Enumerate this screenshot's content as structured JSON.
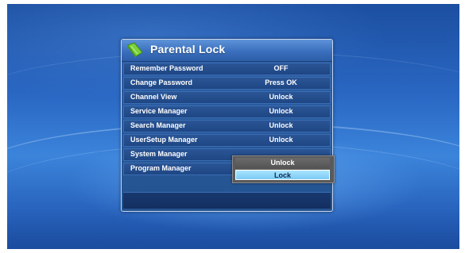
{
  "dialog": {
    "title": "Parental Lock",
    "icon": "green-book-icon"
  },
  "rows": [
    {
      "label": "Remember Password",
      "value": "OFF"
    },
    {
      "label": "Change Password",
      "value": "Press OK"
    },
    {
      "label": "Channel View",
      "value": "Unlock"
    },
    {
      "label": "Service Manager",
      "value": "Unlock"
    },
    {
      "label": "Search Manager",
      "value": "Unlock"
    },
    {
      "label": "UserSetup Manager",
      "value": "Unlock"
    },
    {
      "label": "System Manager",
      "value": ""
    },
    {
      "label": "Program Manager",
      "value": ""
    }
  ],
  "dropdown": {
    "options": [
      "Unlock",
      "Lock"
    ],
    "selected": "Lock"
  },
  "colors": {
    "background": "#2a68c4",
    "dialog": "#24538f",
    "header": "#3a6fbd",
    "highlight": "#7ccaf4"
  }
}
